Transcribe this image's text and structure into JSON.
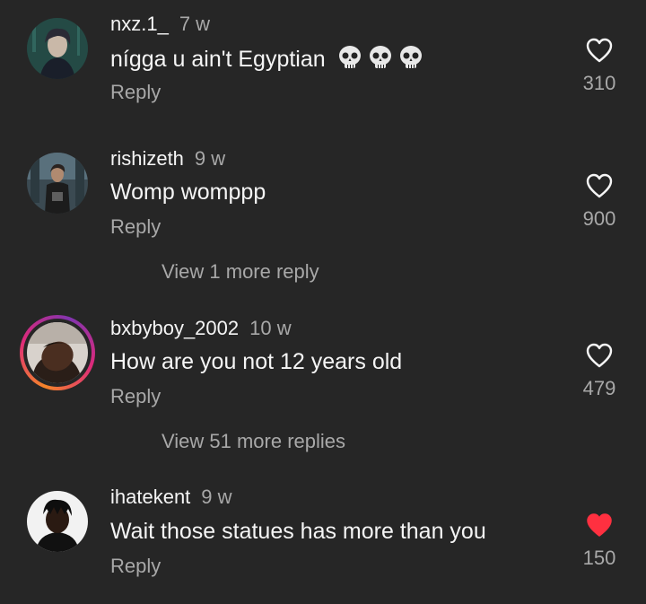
{
  "comments": [
    {
      "username": "nxz.1_",
      "time": "7 w",
      "text": "nígga u ain't Egyptian",
      "emojis": [
        "skull-emoji",
        "skull-emoji",
        "skull-emoji"
      ],
      "reply_label": "Reply",
      "likes": "310",
      "liked": false
    },
    {
      "username": "rishizeth",
      "time": "9 w",
      "text": "Womp womppp",
      "reply_label": "Reply",
      "likes": "900",
      "liked": false,
      "view_more": "View 1 more reply"
    },
    {
      "username": "bxbyboy_2002",
      "time": "10 w",
      "text": "How are you not 12 years old",
      "reply_label": "Reply",
      "likes": "479",
      "liked": false,
      "has_story_ring": true,
      "view_more": "View 51 more replies"
    },
    {
      "username": "ihatekent",
      "time": "9 w",
      "text": "Wait those statues has more than you",
      "reply_label": "Reply",
      "likes": "150",
      "liked": true
    }
  ],
  "colors": {
    "background": "#262626",
    "primary_text": "#f5f5f5",
    "secondary_text": "#a8a8a8",
    "liked_heart": "#ff3040"
  }
}
